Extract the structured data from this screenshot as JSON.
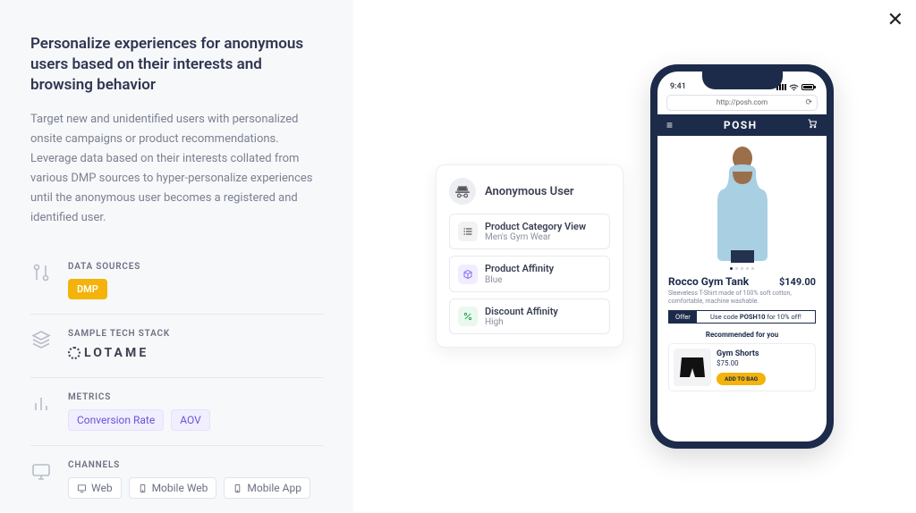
{
  "left": {
    "heading": "Personalize experiences for anonymous users based on their interests and browsing behavior",
    "description": "Target new and unidentified users with personalized onsite campaigns or product recommendations. Leverage data based on their interests collated from various DMP sources to hyper-personalize experiences until the anonymous user becomes a registered and identified user.",
    "sections": {
      "data_sources": {
        "label": "DATA SOURCES",
        "pills": [
          "DMP"
        ]
      },
      "tech_stack": {
        "label": "SAMPLE TECH STACK",
        "brand": "LOTAME"
      },
      "metrics": {
        "label": "METRICS",
        "pills": [
          "Conversion Rate",
          "AOV"
        ]
      },
      "channels": {
        "label": "CHANNELS",
        "items": [
          {
            "icon": "monitor",
            "text": "Web"
          },
          {
            "icon": "phone",
            "text": "Mobile Web"
          },
          {
            "icon": "phone",
            "text": "Mobile App"
          }
        ]
      }
    }
  },
  "viz": {
    "card_title": "Anonymous User",
    "rows": [
      {
        "title": "Product Category View",
        "sub": "Men's Gym Wear"
      },
      {
        "title": "Product Affinity",
        "sub": "Blue"
      },
      {
        "title": "Discount Affinity",
        "sub": "High"
      }
    ]
  },
  "phone": {
    "time": "9:41",
    "url": "http://posh.com",
    "brand": "POSH",
    "product": {
      "name": "Rocco Gym Tank",
      "price": "$149.00",
      "sub": "Sleeveless T-Shirt made of 100% soft cotton, comfortable, machine washable."
    },
    "offer": {
      "tag": "Offer",
      "text_prefix": "Use code ",
      "code": "POSH10",
      "text_suffix": " for 10% off!"
    },
    "rec": {
      "heading": "Recommended for you",
      "name": "Gym Shorts",
      "price": "$75.00",
      "cta": "ADD TO BAG"
    }
  }
}
